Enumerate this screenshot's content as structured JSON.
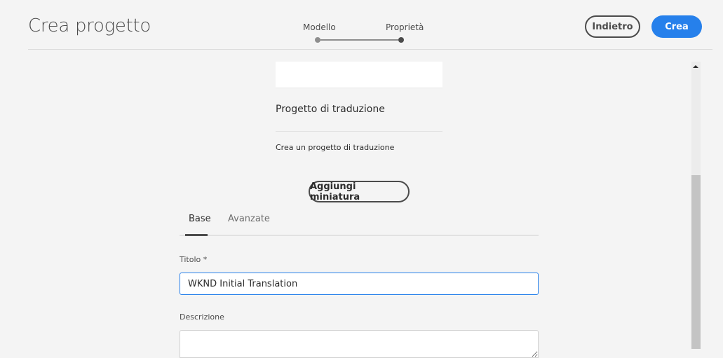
{
  "header": {
    "title": "Crea progetto",
    "steps": [
      {
        "label": "Modello"
      },
      {
        "label": "Proprietà"
      }
    ],
    "back_label": "Indietro",
    "create_label": "Crea"
  },
  "template_card": {
    "title": "Progetto di traduzione",
    "description": "Crea un progetto di traduzione"
  },
  "add_thumbnail_label": "Aggiungi miniatura",
  "tabs": [
    {
      "label": "Base",
      "active": true
    },
    {
      "label": "Avanzate",
      "active": false
    }
  ],
  "form": {
    "title_label": "Titolo *",
    "title_value": "WKND Initial Translation",
    "description_label": "Descrizione",
    "description_value": ""
  },
  "colors": {
    "accent": "#2680eb",
    "background": "#f4f4f4"
  }
}
